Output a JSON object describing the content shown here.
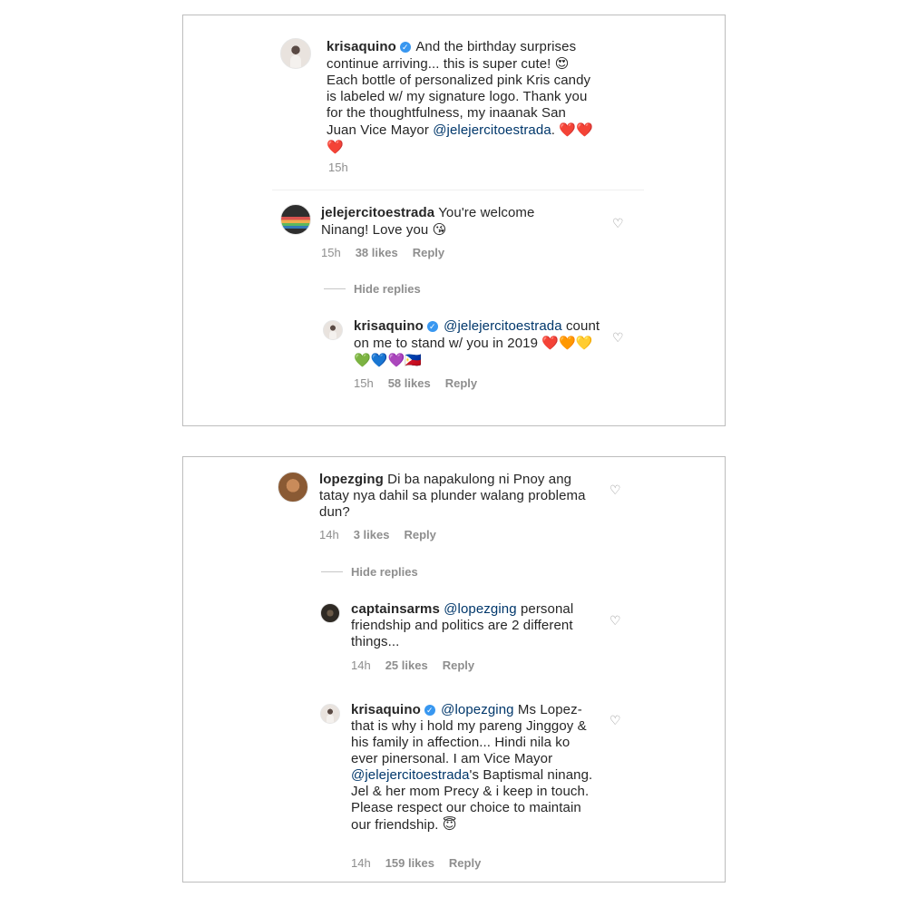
{
  "panel1": {
    "post": {
      "username": "krisaquino",
      "text": "And the birthday surprises continue arriving... this is super cute!",
      "emoji_1": "😍",
      "text_2": "Each bottle of personalized pink Kris candy is labeled w/ my signature logo. Thank you for the thoughtfulness, my inaanak San Juan Vice Mayor",
      "mention": "@jelejercitoestrada",
      "text_3": ".",
      "emoji_2": "❤️❤️❤️",
      "time": "15h"
    },
    "comment1": {
      "username": "jelejercitoestrada",
      "text": "You're welcome Ninang! Love you",
      "emoji": "😘",
      "time": "15h",
      "likes": "38 likes",
      "reply": "Reply"
    },
    "hide_replies": "Hide replies",
    "reply1": {
      "username": "krisaquino",
      "mention": "@jelejercitoestrada",
      "text": "count on me to stand w/ you in 2019",
      "emoji": "❤️🧡💛💚💙💜🇵🇭",
      "time": "15h",
      "likes": "58 likes",
      "reply": "Reply"
    }
  },
  "panel2": {
    "comment1": {
      "username": "lopezging",
      "text": "Di ba napakulong ni Pnoy ang tatay nya dahil sa plunder walang problema dun?",
      "time": "14h",
      "likes": "3 likes",
      "reply": "Reply"
    },
    "hide_replies": "Hide replies",
    "reply1": {
      "username": "captainsarms",
      "mention": "@lopezging",
      "text": "personal friendship and politics are 2 different things...",
      "time": "14h",
      "likes": "25 likes",
      "reply": "Reply"
    },
    "reply2": {
      "username": "krisaquino",
      "mention": "@lopezging",
      "text": "Ms Lopez- that is why i hold my pareng Jinggoy & his family in affection... Hindi nila ko ever pinersonal. I am Vice Mayor",
      "mention_2": "@jelejercitoestrada",
      "text_2": "'s Baptismal ninang. Jel & her mom Precy & i keep in touch. Please respect our choice to maintain our friendship.",
      "emoji": "😇",
      "time": "14h",
      "likes": "159 likes",
      "reply": "Reply"
    }
  },
  "icons": {
    "verified": "verified-badge-icon",
    "like": "heart-outline-icon"
  },
  "colors": {
    "mention": "#00376b",
    "verified": "#3897f0",
    "meta": "#8e8e8e"
  }
}
